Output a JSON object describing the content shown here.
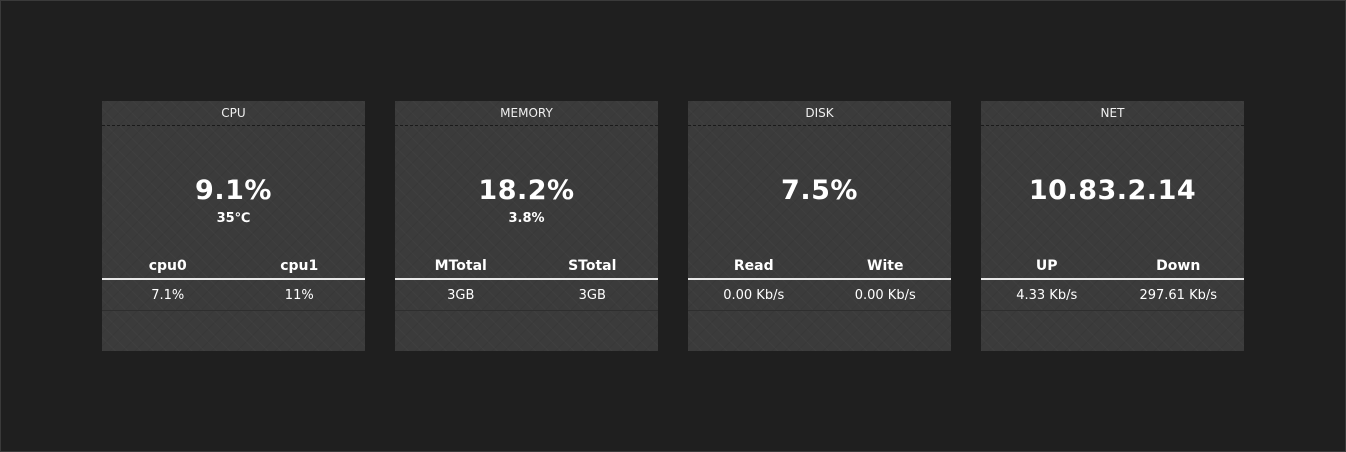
{
  "panels": [
    {
      "title": "CPU",
      "main": "9.1%",
      "sub": "35℃",
      "headers": [
        "cpu0",
        "cpu1"
      ],
      "values": [
        "7.1%",
        "11%"
      ]
    },
    {
      "title": "MEMORY",
      "main": "18.2%",
      "sub": "3.8%",
      "headers": [
        "MTotal",
        "STotal"
      ],
      "values": [
        "3GB",
        "3GB"
      ]
    },
    {
      "title": "DISK",
      "main": "7.5%",
      "sub": "",
      "headers": [
        "Read",
        "Wite"
      ],
      "values": [
        "0.00 Kb/s",
        "0.00 Kb/s"
      ]
    },
    {
      "title": "NET",
      "main": "10.83.2.14",
      "sub": "",
      "headers": [
        "UP",
        "Down"
      ],
      "values": [
        "4.33 Kb/s",
        "297.61 Kb/s"
      ]
    }
  ]
}
